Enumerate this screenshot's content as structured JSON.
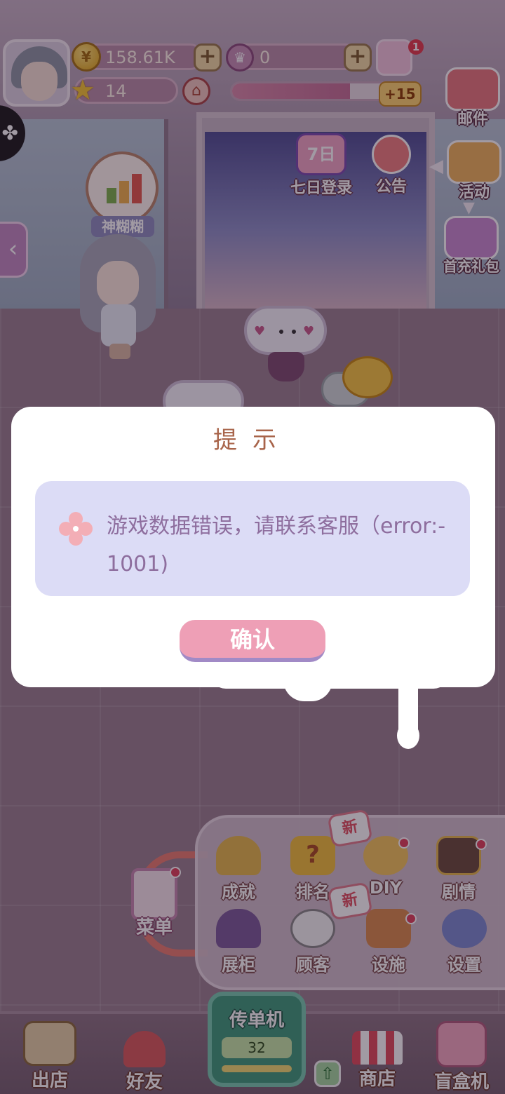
{
  "hud": {
    "coins": "158.61K",
    "gems": "0",
    "stars": "14",
    "level_bonus": "+15",
    "notification_count": "1",
    "progress": 0.72
  },
  "side_buttons": {
    "mail": "邮件",
    "event": "活动",
    "first_recharge": "首充礼包"
  },
  "center_buttons": {
    "seven_day_login": "七日登录",
    "seven_day_badge": "7日",
    "announcement": "公告"
  },
  "scene": {
    "chart_label": "神糊糊"
  },
  "dialog": {
    "title": "提示",
    "message": "游戏数据错误，请联系客服（error:-1001)",
    "confirm": "确认"
  },
  "menu": {
    "new_badge": "新",
    "items": [
      {
        "label": "成就"
      },
      {
        "label": "排名"
      },
      {
        "label": "DIY"
      },
      {
        "label": "剧情"
      },
      {
        "label": "展柜"
      },
      {
        "label": "顾客"
      },
      {
        "label": "设施"
      },
      {
        "label": "设置"
      }
    ],
    "caidan": "菜单"
  },
  "bottom_bar": {
    "exit_store": "出店",
    "friends": "好友",
    "flyer_title": "传单机",
    "flyer_count": "32",
    "shop": "商店",
    "blind_box": "盲盒机"
  },
  "colors": {
    "dialog_title": "#a8644a",
    "message_text": "#8e6e9e",
    "message_bg": "#dcdcf6",
    "confirm_bg": "#ee9fb6"
  }
}
